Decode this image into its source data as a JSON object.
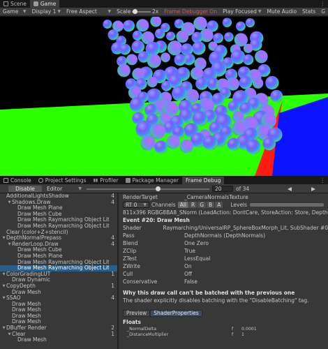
{
  "top_tabs": [
    {
      "label": "Scene",
      "active": false
    },
    {
      "label": "Game",
      "active": true
    }
  ],
  "game_toolbar": {
    "display_mode": "Game",
    "display": "Display 1",
    "aspect": "Free Aspect",
    "scale_label": "Scale",
    "scale_value": "2x",
    "frame_debugger": "Frame Debugger On",
    "play_mode": "Play Focused",
    "mute": "Mute Audio",
    "stats": "Stats",
    "gizmos": "G"
  },
  "bottom_tabs": [
    {
      "label": "Console",
      "active": false
    },
    {
      "label": "Project Settings",
      "active": false
    },
    {
      "label": "Profiler",
      "active": false
    },
    {
      "label": "Package Manager",
      "active": false
    },
    {
      "label": "Frame Debug",
      "active": true
    }
  ],
  "frame_debug": {
    "disable_label": "Disable",
    "target": "Editor",
    "current": "20",
    "of_total": "of 34",
    "slider_fraction": 0.58
  },
  "tree": [
    {
      "indent": 1,
      "arrow": false,
      "label": "AdditionalLightsShadow",
      "count": "4"
    },
    {
      "indent": 2,
      "arrow": true,
      "label": "Shadows.Draw",
      "count": "4"
    },
    {
      "indent": 3,
      "arrow": false,
      "label": "Draw Mesh Plane",
      "count": ""
    },
    {
      "indent": 3,
      "arrow": false,
      "label": "Draw Mesh Cube",
      "count": ""
    },
    {
      "indent": 3,
      "arrow": false,
      "label": "Draw Mesh Raymarching Object Lit (1)",
      "count": ""
    },
    {
      "indent": 3,
      "arrow": false,
      "label": "Draw Mesh Raymarching Object Lit",
      "count": ""
    },
    {
      "indent": 1,
      "arrow": false,
      "label": "Clear (color+Z+stencil)",
      "count": ""
    },
    {
      "indent": 1,
      "arrow": true,
      "label": "DepthNormalPrepass",
      "count": "4"
    },
    {
      "indent": 2,
      "arrow": true,
      "label": "RenderLoop.Draw",
      "count": "4"
    },
    {
      "indent": 3,
      "arrow": false,
      "label": "Draw Mesh Cube",
      "count": ""
    },
    {
      "indent": 3,
      "arrow": false,
      "label": "Draw Mesh Plane",
      "count": ""
    },
    {
      "indent": 3,
      "arrow": false,
      "label": "Draw Mesh Raymarching Object Lit",
      "count": ""
    },
    {
      "indent": 3,
      "arrow": false,
      "label": "Draw Mesh Raymarching Object Lit (1)",
      "count": "",
      "selected": true
    },
    {
      "indent": 1,
      "arrow": true,
      "label": "ColorGradingLUT",
      "count": "1"
    },
    {
      "indent": 2,
      "arrow": false,
      "label": "Draw Dynamic",
      "count": ""
    },
    {
      "indent": 1,
      "arrow": true,
      "label": "CopyDepth",
      "count": "1"
    },
    {
      "indent": 2,
      "arrow": false,
      "label": "Draw Mesh",
      "count": ""
    },
    {
      "indent": 1,
      "arrow": true,
      "label": "SSAO",
      "count": "4"
    },
    {
      "indent": 2,
      "arrow": false,
      "label": "Draw Mesh",
      "count": ""
    },
    {
      "indent": 2,
      "arrow": false,
      "label": "Draw Mesh",
      "count": ""
    },
    {
      "indent": 2,
      "arrow": false,
      "label": "Draw Mesh",
      "count": ""
    },
    {
      "indent": 2,
      "arrow": false,
      "label": "Draw Mesh",
      "count": ""
    },
    {
      "indent": 1,
      "arrow": true,
      "label": "DBuffer Render",
      "count": "2"
    },
    {
      "indent": 2,
      "arrow": true,
      "label": "Clear",
      "count": "1"
    },
    {
      "indent": 3,
      "arrow": false,
      "label": "Draw Mesh",
      "count": ""
    }
  ],
  "details": {
    "render_target_key": "RenderTarget",
    "render_target_value": "_CameraNormalsTexture",
    "rt_select": "RT 0",
    "channels_label": "Channels",
    "channels": [
      "All",
      "R",
      "G",
      "B",
      "A"
    ],
    "levels_label": "Levels",
    "format_line": "811x396 RGBG8BA8_SNorm (LoadAction: DontCare, StoreAction: Store, Depth LoadAction",
    "event_title": "Event #20: Draw Mesh",
    "props": [
      {
        "key": "Shader",
        "value": "Raymarching/UniversalRP_SphereBoxMorph_Lit, SubShader #0"
      },
      {
        "key": "Pass",
        "value": "DepthNormals (DepthNormals)"
      },
      {
        "key": "Blend",
        "value": "One Zero"
      },
      {
        "key": "ZClip",
        "value": "True"
      },
      {
        "key": "ZTest",
        "value": "LessEqual"
      },
      {
        "key": "ZWrite",
        "value": "On"
      },
      {
        "key": "Cull",
        "value": "Off"
      },
      {
        "key": "Conservative",
        "value": "False"
      }
    ],
    "batch_title": "Why this draw call can't be batched with the previous one",
    "batch_reason": "The shader explicitly disables batching with the \"DisableBatching\" tag.",
    "subtabs": [
      "Preview",
      "ShaderProperties"
    ],
    "floats_title": "Floats",
    "floats": [
      {
        "name": "_NormalDelta",
        "type": "f",
        "value": "0.0001"
      },
      {
        "name": "_DistanceMultiplier",
        "type": "f",
        "value": "1"
      }
    ]
  },
  "colors": {
    "panel": "#383838",
    "toolbar": "#3c3c3c",
    "selected": "#2c5d87",
    "ground_green": "#2bff00",
    "wall_blue": "#0a12ff",
    "wall_red": "#ff1a12"
  }
}
